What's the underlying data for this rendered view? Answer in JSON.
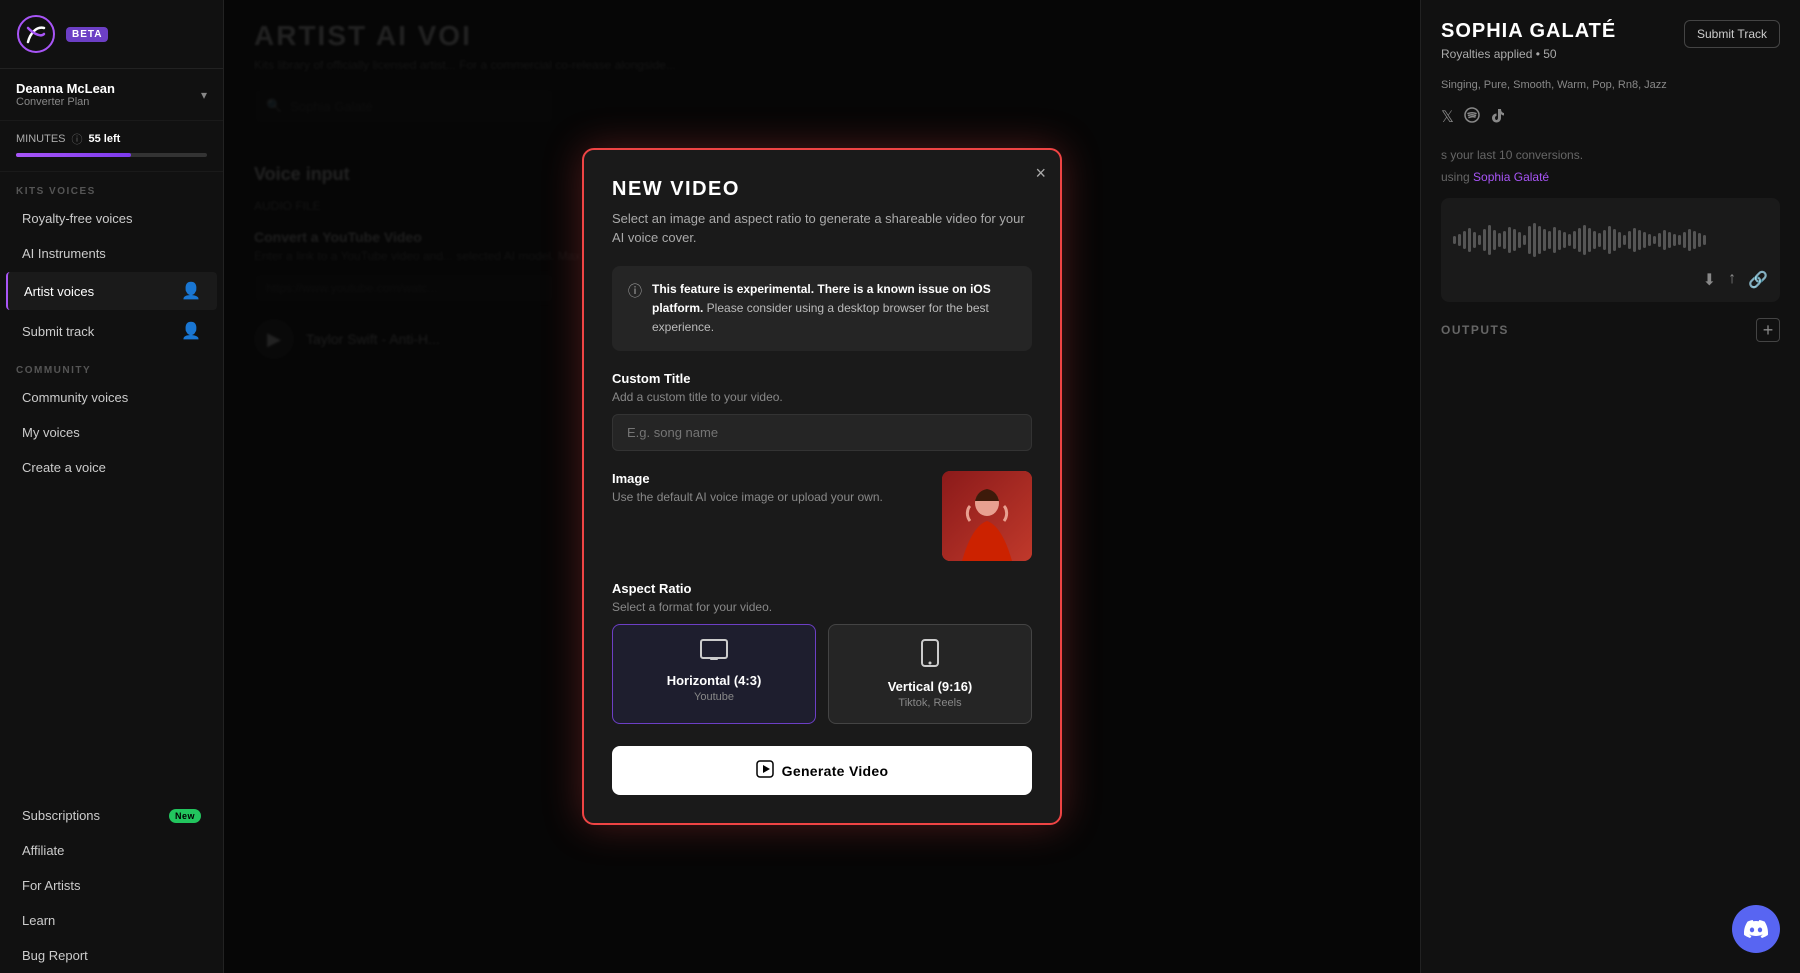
{
  "sidebar": {
    "beta_label": "BETA",
    "user": {
      "name": "Deanna McLean",
      "plan": "Converter Plan",
      "chevron": "▾"
    },
    "minutes": {
      "label": "MINUTES",
      "left": "55 left",
      "progress": 60
    },
    "kits_voices_section": "KITS VOICES",
    "items_kits": [
      {
        "id": "royalty-free",
        "label": "Royalty-free voices",
        "icon": "",
        "badge": null
      },
      {
        "id": "ai-instruments",
        "label": "AI Instruments",
        "icon": "",
        "badge": null
      },
      {
        "id": "artist-voices",
        "label": "Artist voices",
        "icon": "👤+",
        "badge": null,
        "active": true
      },
      {
        "id": "submit-track",
        "label": "Submit track",
        "icon": "👤+",
        "badge": null
      }
    ],
    "community_section": "COMMUNITY",
    "items_community": [
      {
        "id": "community-voices",
        "label": "Community voices",
        "badge": null
      },
      {
        "id": "my-voices",
        "label": "My voices",
        "badge": null
      },
      {
        "id": "create-voice",
        "label": "Create a voice",
        "badge": null
      }
    ],
    "items_bottom": [
      {
        "id": "subscriptions",
        "label": "Subscriptions",
        "badge": "New"
      },
      {
        "id": "affiliate",
        "label": "Affiliate",
        "badge": null
      },
      {
        "id": "for-artists",
        "label": "For Artists",
        "badge": null
      },
      {
        "id": "learn",
        "label": "Learn",
        "badge": null
      },
      {
        "id": "bug-report",
        "label": "Bug Report",
        "badge": null
      }
    ]
  },
  "main": {
    "artist_heading": "ARTIST AI VOI",
    "artist_sub": "Kits library of officially licensed artist... For a commercial co-release alongside...",
    "search_placeholder": "Sophia Galaté",
    "voice_input_title": "Voice input",
    "audio_file_tab": "AUDIO FILE",
    "yt_convert_title": "Convert a YouTube Video",
    "yt_convert_sub": "Enter a link to a YouTube video and... selected AI model. Max video lengt...",
    "yt_placeholder": "https://www.youtube.com/watc...",
    "yt_video_label": "Taylor Swift - Anti-H..."
  },
  "right_panel": {
    "artist_name": "SOPHIA GALATÉ",
    "submit_track": "Submit Track",
    "royalties": "Royalties applied • 50",
    "tags": "Singing, Pure, Smooth, Warm, Pop, Rn8, Jazz",
    "social_icons": [
      "𝕏",
      "♫",
      "♪"
    ],
    "last_conversion_label": "s your last 10 conversions.",
    "using_label": "using",
    "artist_ref": "Sophia Galaté",
    "outputs_label": "OUTPUTS",
    "add_icon": "+"
  },
  "modal": {
    "title": "NEW VIDEO",
    "subtitle": "Select an image and aspect ratio to generate a shareable video for your AI voice cover.",
    "close_label": "×",
    "info_text_bold": "This feature is experimental. There is a known issue on iOS platform.",
    "info_text_rest": " Please consider using a desktop browser for the best experience.",
    "custom_title_label": "Custom Title",
    "custom_title_hint": "Add a custom title to your video.",
    "custom_title_placeholder": "E.g. song name",
    "image_label": "Image",
    "image_hint": "Use the default AI voice image or upload your own.",
    "aspect_label": "Aspect Ratio",
    "aspect_hint": "Select a format for your video.",
    "aspect_options": [
      {
        "id": "horizontal",
        "icon": "🖥",
        "label": "Horizontal (4:3)",
        "sub": "Youtube",
        "selected": true
      },
      {
        "id": "vertical",
        "icon": "📱",
        "label": "Vertical (9:16)",
        "sub": "Tiktok, Reels",
        "selected": false
      }
    ],
    "generate_btn": "Generate Video"
  },
  "discord": {
    "icon": "💬"
  }
}
